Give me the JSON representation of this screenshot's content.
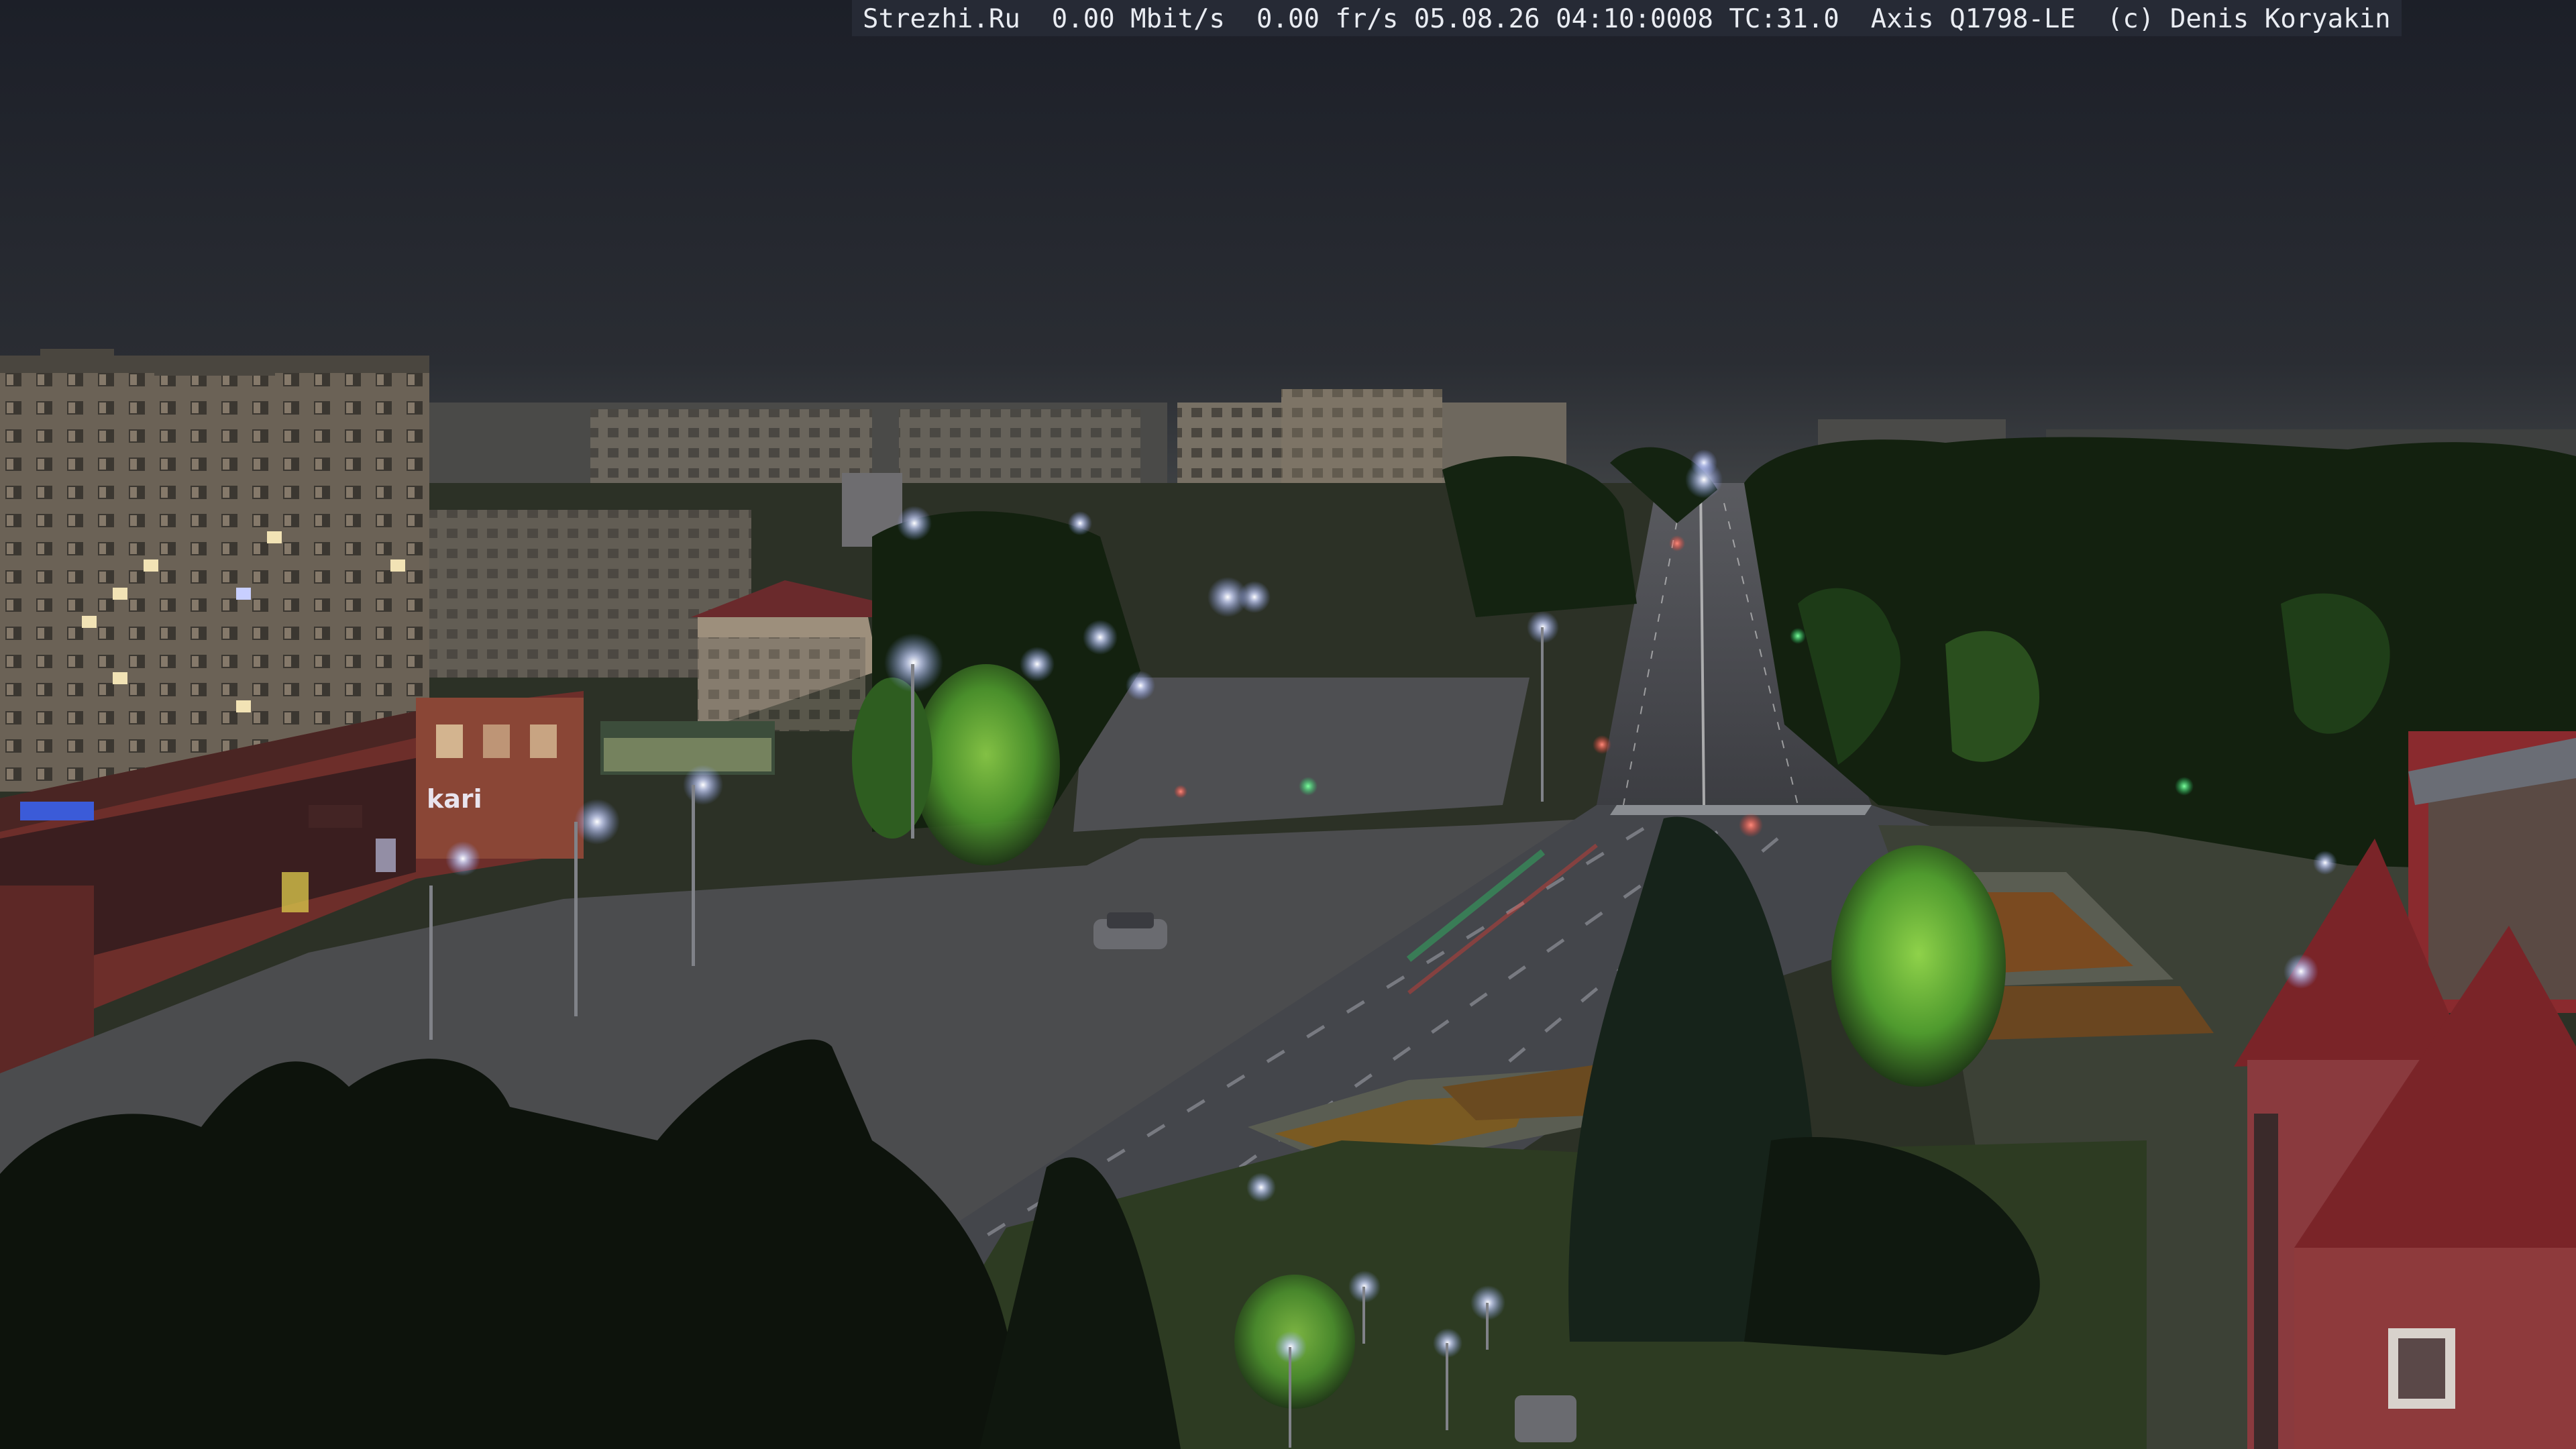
{
  "camera_overlay": {
    "text": "Strezhi.Ru  0.00 Mbit/s  0.00 fr/s 05.08.26 04:10:0008 TC:31.0  Axis Q1798-LE  (c) Denis Koryakin"
  },
  "signs": {
    "store_left": "kari"
  },
  "colors": {
    "sky": "#1f222b",
    "horizon": "#3d4043",
    "building_panel": "#6b6256",
    "building_window": "#f2e3b5",
    "shop_red": "#6d2e2a",
    "asphalt": "#45464a",
    "lamp_light": "#f0f4ff",
    "tree_dark": "#0f160f",
    "tree_lit": "#4f9a2e",
    "grass": "#3a4a2c",
    "flowerbed": "#7a4a20",
    "traffic_green": "#25e06c",
    "traffic_red": "#ff3a2e",
    "roof_red": "#8a2a2e",
    "overlay_bg": "#262a35",
    "overlay_text": "#e9ecf2"
  }
}
